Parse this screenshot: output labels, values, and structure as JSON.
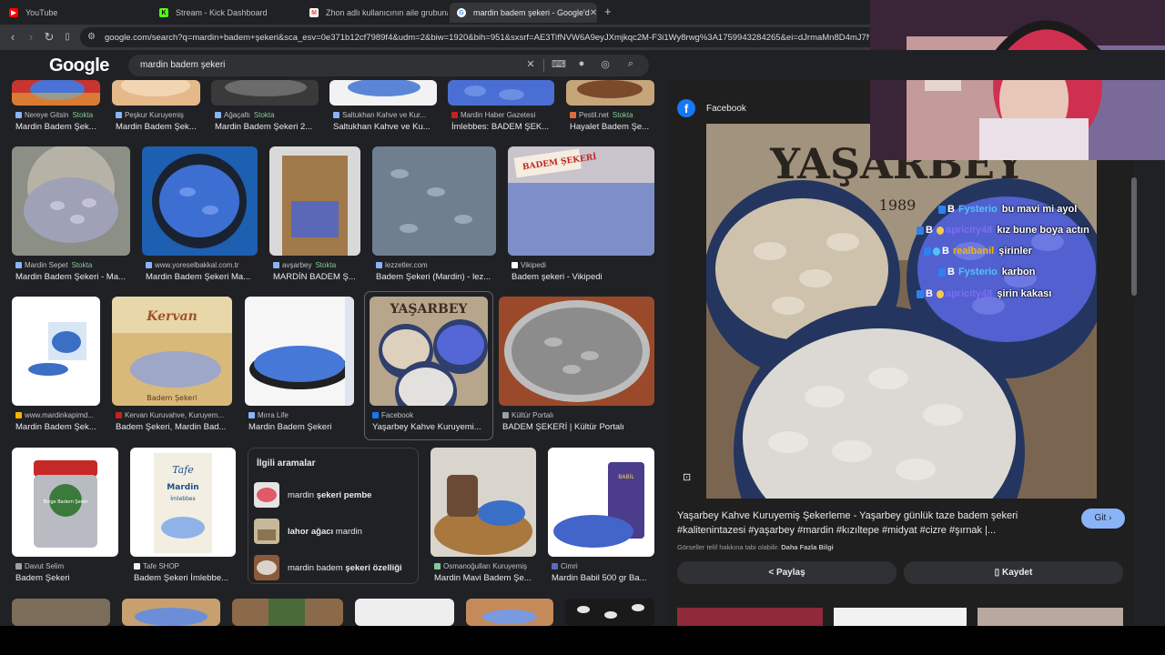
{
  "browser": {
    "tabs": [
      {
        "title": "YouTube",
        "icon": "youtube-icon"
      },
      {
        "title": "Stream - Kick Dashboard",
        "icon": "kick-icon"
      },
      {
        "title": "Zhon adlı kullanıcının aile grubuna k",
        "icon": "gmail-icon"
      },
      {
        "title": "mardin badem şekeri - Google'd",
        "icon": "google-icon"
      }
    ],
    "url": "google.com/search?q=mardin+badem+şekeri&sca_esv=0e371b12cf7989f4&udm=2&biw=1920&bih=951&sxsrf=AE3TifNVW6A9eyJXmjkqc2M-F3i1Wy8rwg%3A1759943284265&ei=dJrmaMn8D4mJ7NYPi"
  },
  "google": {
    "logo": "Google",
    "query": "mardin badem şekeri"
  },
  "results": {
    "row1": [
      {
        "source": "Nereye Gitsin",
        "stock": "Stokta",
        "title": "Mardin Badem Şek..."
      },
      {
        "source": "Peşkur Kuruyemiş",
        "stock": "",
        "title": "Mardin Badem Şek..."
      },
      {
        "source": "Ağaçaltı",
        "stock": "Stokta",
        "title": "Mardin Badem Şekeri 2..."
      },
      {
        "source": "Saltukhan Kahve ve Kur...",
        "stock": "",
        "title": "Saltukhan Kahve ve Ku..."
      },
      {
        "source": "Mardin Haber Gazetesi",
        "stock": "",
        "title": "İmlebbes: BADEM ŞEK..."
      },
      {
        "source": "Pestil.net",
        "stock": "Stokta",
        "title": "Hayalet Badem Şe..."
      }
    ],
    "row2": [
      {
        "source": "Mardin Sepet",
        "stock": "Stokta",
        "title": "Mardin Badem Şekeri - Ma..."
      },
      {
        "source": "www.yoreselbakkal.com.tr",
        "stock": "",
        "title": "Mardin Badem Şekeri Ma..."
      },
      {
        "source": "avşarbey",
        "stock": "Stokta",
        "title": "MARDİN BADEM Ş..."
      },
      {
        "source": "lezzetler.com",
        "stock": "",
        "title": "Badem Şekeri (Mardin) - lez..."
      },
      {
        "source": "Vikipedi",
        "stock": "",
        "title": "Badem şekeri - Vikipedi"
      }
    ],
    "row3": [
      {
        "source": "www.mardinkapimd...",
        "stock": "",
        "title": "Mardin Badem Şek..."
      },
      {
        "source": "Kervan Kuruvahve, Kuruyem...",
        "stock": "",
        "title": "Badem Şekeri, Mardin Bad..."
      },
      {
        "source": "Mırra Life",
        "stock": "",
        "title": "Mardin Badem Şekeri"
      },
      {
        "source": "Facebook",
        "stock": "",
        "title": "Yaşarbey Kahve Kuruyemi..."
      },
      {
        "source": "Kültür Portalı",
        "stock": "",
        "title": "BADEM ŞEKERİ | Kültür Portalı"
      }
    ],
    "row4": [
      {
        "source": "Davut Selim",
        "stock": "",
        "title": "Badem Şekeri"
      },
      {
        "source": "Tafe SHOP",
        "stock": "",
        "title": "Badem Şekeri İmlebbe..."
      },
      {
        "source": "Osmanoğulları Kuruyemiş",
        "stock": "",
        "title": "Mardin Mavi Badem Şe..."
      },
      {
        "source": "Cimri",
        "stock": "",
        "title": "Mardin Babil 500 gr Ba..."
      }
    ],
    "image_labels": {
      "kervan": "Kervan",
      "kervan_sub": "Badem Şekeri",
      "yasarbey": "YAŞARBEY",
      "yasarbey_year": "1989",
      "badem_sign": "BADEM ŞEKERİ",
      "tafe_brand": "Tafe",
      "tafe_city": "Mardin",
      "tafe_sub": "İmlebbes",
      "jar_label": "Bolge Badem Şeker",
      "babil": "BABİL"
    }
  },
  "related": {
    "heading": "İlgili aramalar",
    "items": [
      {
        "pre": "mardin ",
        "bold": "şekeri pembe",
        "post": ""
      },
      {
        "pre": "",
        "bold": "lahor ağacı",
        "post": " mardin"
      },
      {
        "pre": "mardin badem ",
        "bold": "şekeri özelliği",
        "post": ""
      }
    ]
  },
  "preview": {
    "source": "Facebook",
    "sign": "YAŞARBEY",
    "year": "1989",
    "title": "Yaşarbey Kahve Kuruyemiş Şekerleme - Yaşarbey günlük taze badem şekeri #kalitenintazesi #yaşarbey #mardin #kızıltepe #midyat #cizre #şırnak |...",
    "visit": "Git",
    "copyright": "Görseller telif hakkına tabi olabilir.",
    "more_info": "Daha Fazla Bilgi",
    "share": "Paylaş",
    "save": "Kaydet"
  },
  "chat": [
    {
      "user": "Fysterio",
      "color": "#4fc3f7",
      "msg": "bu mavi mi ayol",
      "badge": "B"
    },
    {
      "user": "apricity48",
      "color": "#7c6cf0",
      "msg": "kız bune boya actın",
      "badge": "B"
    },
    {
      "user": "realbanil",
      "color": "#f5b700",
      "msg": "şirinler",
      "badge": "B"
    },
    {
      "user": "Fysterio",
      "color": "#4fc3f7",
      "msg": "karbon",
      "badge": "B"
    },
    {
      "user": "apricity48",
      "color": "#7c6cf0",
      "msg": "şirin kakası",
      "badge": "B"
    }
  ],
  "colors": {
    "background": "#202124",
    "accent": "#8ab4f8",
    "stock_green": "#81c995",
    "candy_blue": "#4a6fd4",
    "candy_white": "#d9d5cf"
  }
}
